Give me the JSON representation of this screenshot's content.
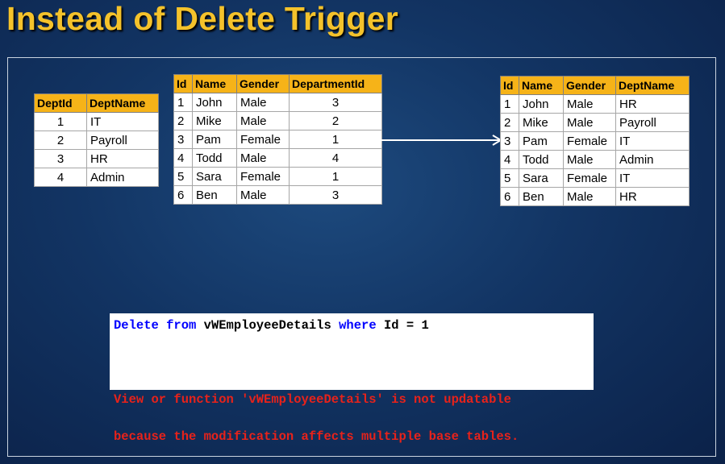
{
  "title": "Instead of Delete Trigger",
  "colors": {
    "title": "#f4c22b",
    "header": "#f6b318",
    "keyword": "#0000ff",
    "error": "#e8221a",
    "background": "#123463"
  },
  "dept_table": {
    "headers": [
      "DeptId",
      "DeptName"
    ],
    "rows": [
      [
        "1",
        "IT"
      ],
      [
        "2",
        "Payroll"
      ],
      [
        "3",
        "HR"
      ],
      [
        "4",
        "Admin"
      ]
    ]
  },
  "employee_table": {
    "headers": [
      "Id",
      "Name",
      "Gender",
      "DepartmentId"
    ],
    "rows": [
      [
        "1",
        "John",
        "Male",
        "3"
      ],
      [
        "2",
        "Mike",
        "Male",
        "2"
      ],
      [
        "3",
        "Pam",
        "Female",
        "1"
      ],
      [
        "4",
        "Todd",
        "Male",
        "4"
      ],
      [
        "5",
        "Sara",
        "Female",
        "1"
      ],
      [
        "6",
        "Ben",
        "Male",
        "3"
      ]
    ]
  },
  "view_table": {
    "headers": [
      "Id",
      "Name",
      "Gender",
      "DeptName"
    ],
    "rows": [
      [
        "1",
        "John",
        "Male",
        "HR"
      ],
      [
        "2",
        "Mike",
        "Male",
        "Payroll"
      ],
      [
        "3",
        "Pam",
        "Female",
        "IT"
      ],
      [
        "4",
        "Todd",
        "Male",
        "Admin"
      ],
      [
        "5",
        "Sara",
        "Female",
        "IT"
      ],
      [
        "6",
        "Ben",
        "Male",
        "HR"
      ]
    ]
  },
  "code": {
    "kw_delete": "Delete",
    "kw_from": "from",
    "view_name": "vWEmployeeDetails",
    "kw_where": "where",
    "condition": "Id = 1",
    "error_line1": "View or function 'vWEmployeeDetails' is not updatable",
    "error_line2": "because the modification affects multiple base tables."
  }
}
